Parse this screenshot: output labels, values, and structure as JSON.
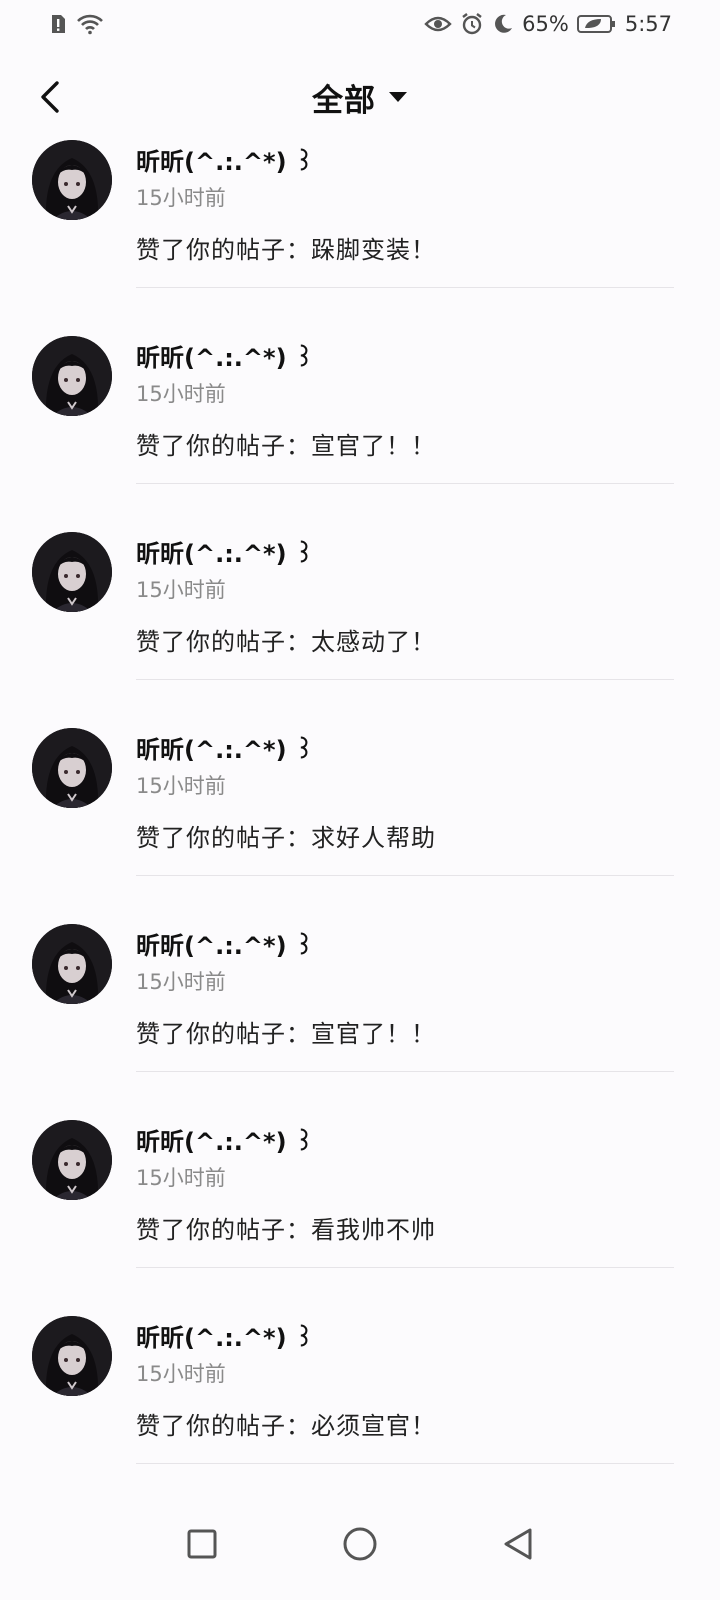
{
  "status_bar": {
    "battery_percent": "65%",
    "time": "5:57",
    "icons": [
      "sim-alert-icon",
      "wifi-icon",
      "eye-icon",
      "alarm-icon",
      "moon-icon",
      "battery-icon"
    ]
  },
  "header": {
    "title": "全部",
    "back_icon": "chevron-left-icon",
    "dropdown_icon": "caret-down-icon"
  },
  "notifications": [
    {
      "username": "昕昕(^.:.^*) ꒱",
      "time": "15小时前",
      "message": "赞了你的帖子：跺脚变装！"
    },
    {
      "username": "昕昕(^.:.^*) ꒱",
      "time": "15小时前",
      "message": "赞了你的帖子：宣官了！！"
    },
    {
      "username": "昕昕(^.:.^*) ꒱",
      "time": "15小时前",
      "message": "赞了你的帖子：太感动了！"
    },
    {
      "username": "昕昕(^.:.^*) ꒱",
      "time": "15小时前",
      "message": "赞了你的帖子：求好人帮助"
    },
    {
      "username": "昕昕(^.:.^*) ꒱",
      "time": "15小时前",
      "message": "赞了你的帖子：宣官了！！"
    },
    {
      "username": "昕昕(^.:.^*) ꒱",
      "time": "15小时前",
      "message": "赞了你的帖子：看我帅不帅"
    },
    {
      "username": "昕昕(^.:.^*) ꒱",
      "time": "15小时前",
      "message": "赞了你的帖子：必须宣官！"
    }
  ],
  "navbar": {
    "icons": [
      "recents-square-icon",
      "home-circle-icon",
      "back-triangle-icon"
    ]
  }
}
